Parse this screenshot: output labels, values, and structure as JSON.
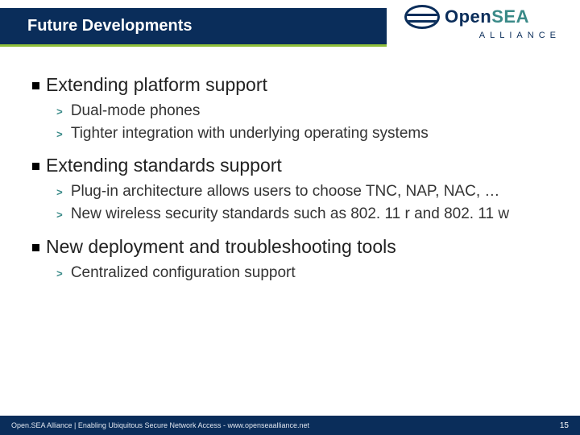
{
  "title": "Future Developments",
  "logo": {
    "brand_open": "Open",
    "brand_sea": "SEA",
    "sub": "ALLIANCE"
  },
  "sections": [
    {
      "heading": "Extending platform support",
      "items": [
        "Dual-mode phones",
        "Tighter integration with underlying operating systems"
      ]
    },
    {
      "heading": "Extending standards support",
      "items": [
        "Plug-in architecture allows users to choose TNC, NAP, NAC, …",
        "New wireless security standards such as 802. 11 r and 802. 11 w"
      ]
    },
    {
      "heading": "New deployment and troubleshooting tools",
      "items": [
        "Centralized configuration support"
      ]
    }
  ],
  "footer": {
    "text": "Open.SEA Alliance | Enabling Ubiquitous Secure Network Access - www.openseaalliance.net",
    "page": "15"
  }
}
